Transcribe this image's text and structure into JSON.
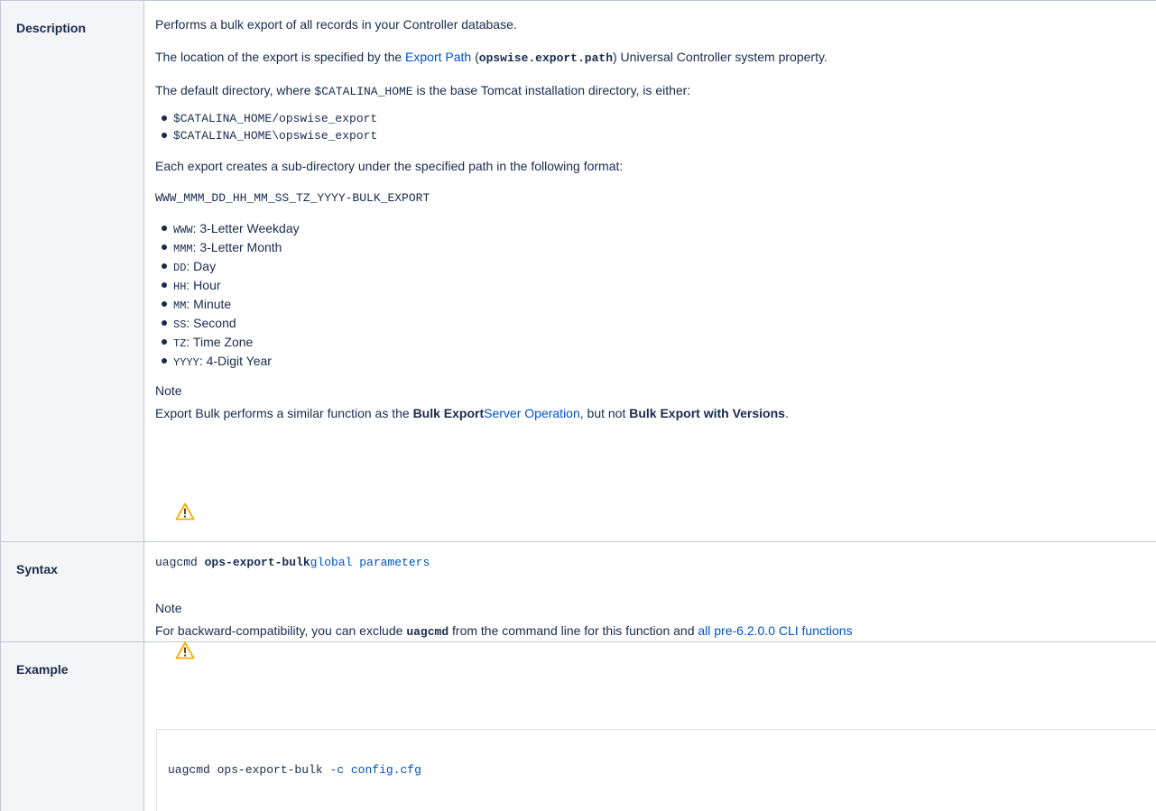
{
  "rows": {
    "description": {
      "label": "Description",
      "intro": "Performs a bulk export of all records in your Controller database.",
      "location": {
        "before": "The location of the export is specified by the ",
        "link": "Export Path",
        "paren_open": " (",
        "property": "opswise.export.path",
        "after": ") Universal Controller system property."
      },
      "default_dir": {
        "before": "The default directory, where ",
        "var": "$CATALINA_HOME",
        "after": " is the base Tomcat installation directory, is either:"
      },
      "paths": [
        "$CATALINA_HOME/opswise_export",
        "$CATALINA_HOME\\opswise_export"
      ],
      "subdir_text": "Each export creates a sub-directory under the specified path in the following format:",
      "format": "WWW_MMM_DD_HH_MM_SS_TZ_YYYY-BULK_EXPORT",
      "fields": [
        {
          "code": "WWW",
          "text": ": 3-Letter Weekday"
        },
        {
          "code": "MMM",
          "text": ": 3-Letter Month"
        },
        {
          "code": "DD",
          "text": ": Day"
        },
        {
          "code": "HH",
          "text": ": Hour"
        },
        {
          "code": "MM",
          "text": ": Minute"
        },
        {
          "code": "SS",
          "text": ": Second"
        },
        {
          "code": "TZ",
          "text": ": Time Zone"
        },
        {
          "code": "YYYY",
          "text": ": 4-Digit Year"
        }
      ],
      "note": {
        "label": "Note",
        "before": "Export Bulk performs a similar function as the ",
        "bold1": "Bulk Export",
        "link": "Server Operation",
        "mid": ", but not ",
        "bold2": "Bulk Export with Versions",
        "end": "."
      }
    },
    "syntax": {
      "label": "Syntax",
      "cmd": "uagcmd ",
      "cmd_bold": "ops-export-bulk",
      "params_link": "global parameters",
      "note": {
        "label": "Note",
        "before": "For backward-compatibility, you can exclude ",
        "code": "uagcmd",
        "after": " from the command line for this function and ",
        "link": "all pre-6.2.0.0 CLI functions"
      }
    },
    "example": {
      "label": "Example",
      "cmd": "uagcmd ops-export-bulk ",
      "flag": "-c",
      "space": " ",
      "file": "config.cfg"
    }
  },
  "colors": {
    "link": "#0052cc",
    "warning": "#ffab00",
    "header_bg": "#f4f5f7",
    "border": "#c1c7d0"
  },
  "icons": [
    "warning-icon"
  ]
}
